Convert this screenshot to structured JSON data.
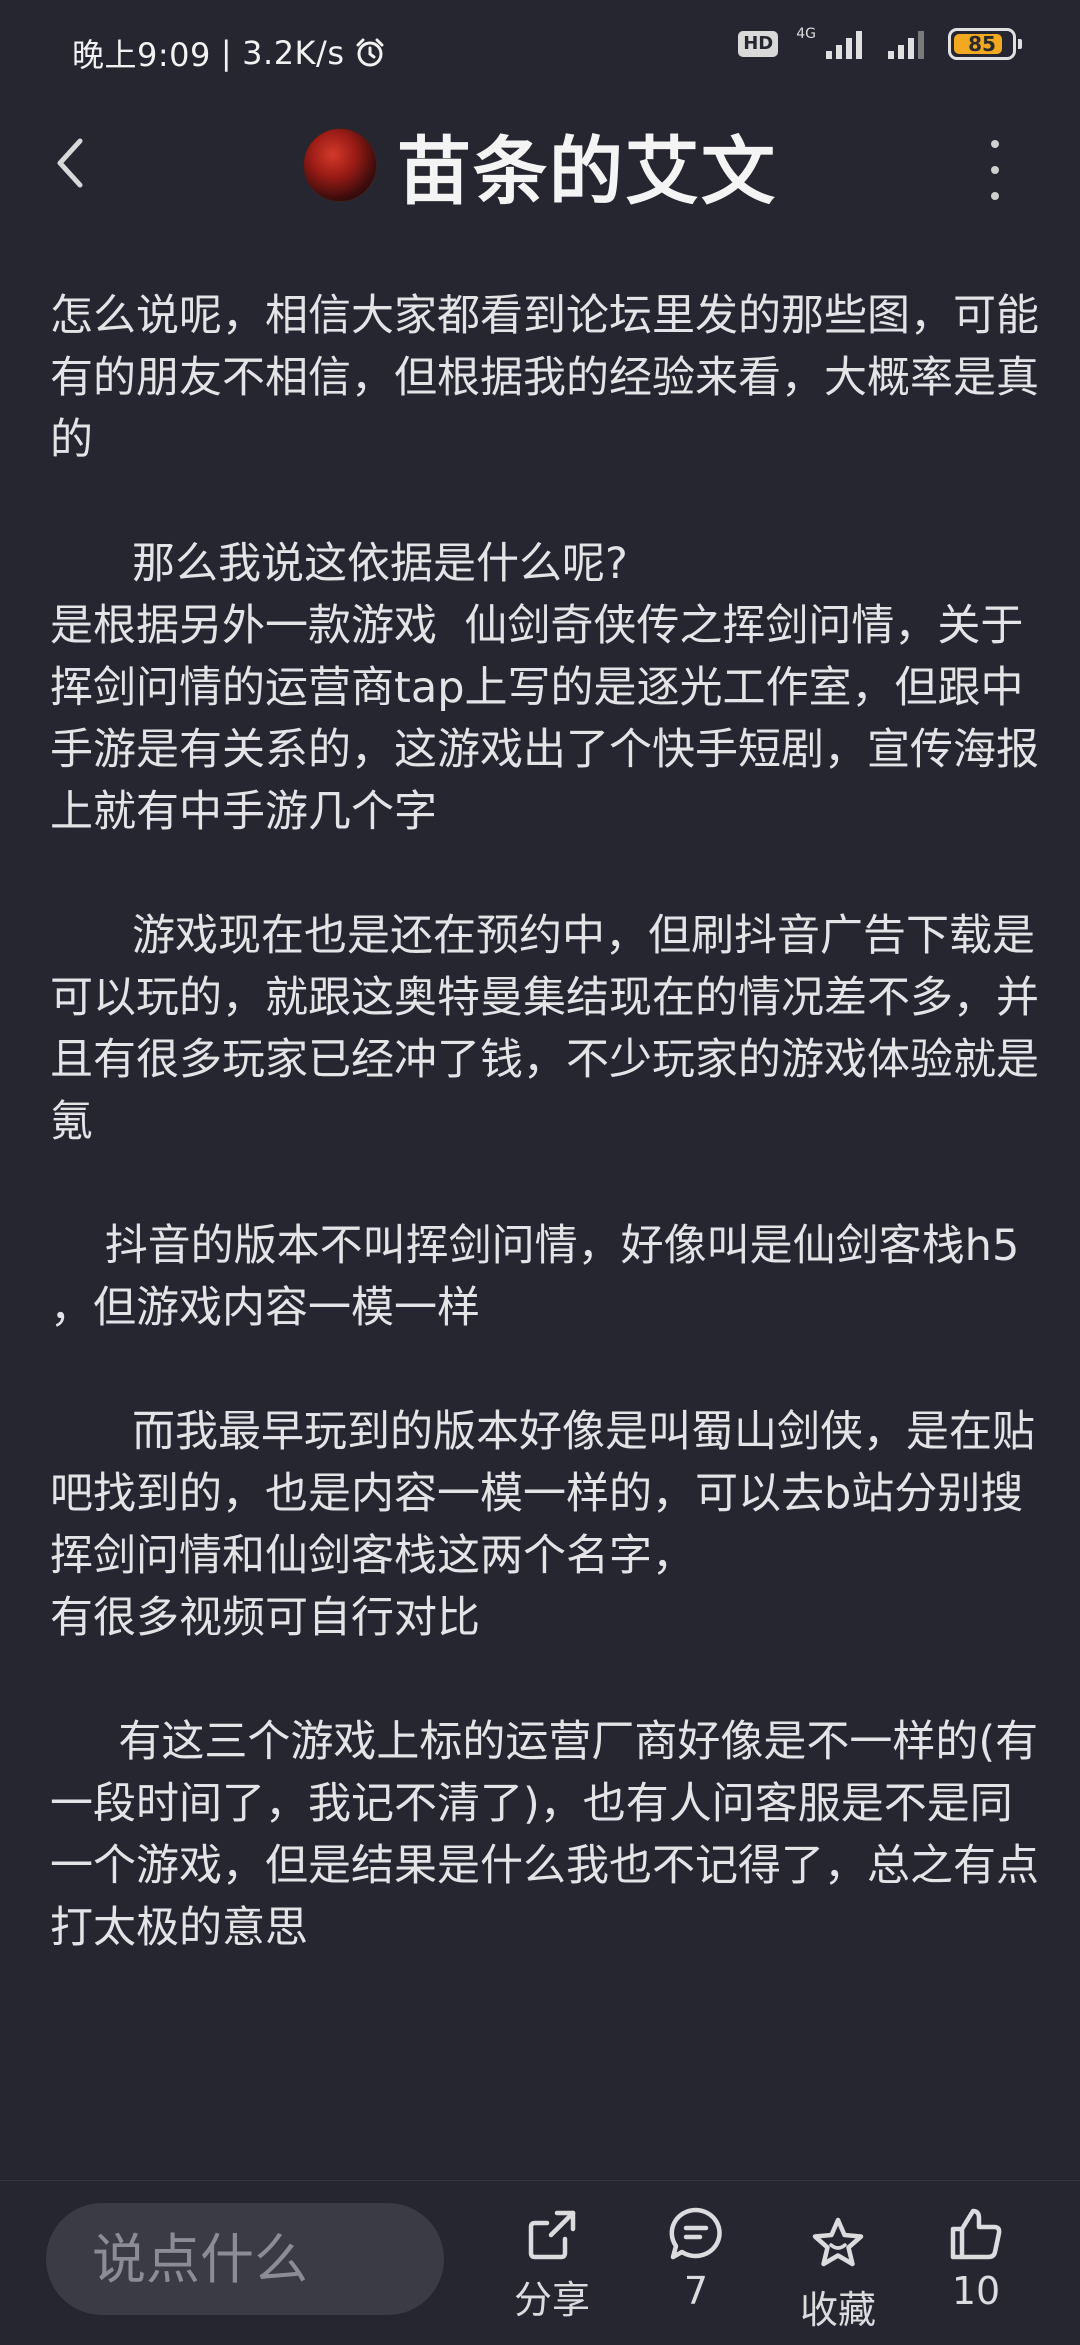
{
  "status_bar": {
    "time": "晚上9:09",
    "separator": "|",
    "speed": "3.2K/s",
    "hd": "HD",
    "network": "4G",
    "battery": "85",
    "battery_fraction": 0.85,
    "battery_color": "#f2a81f"
  },
  "header": {
    "title": "苗条的艾文"
  },
  "article": {
    "paragraphs": [
      "怎么说呢，相信大家都看到论坛里发的那些图，可能有的朋友不相信，但根据我的经验来看，大概率是真的",
      "      那么我说这依据是什么呢?\n是根据另外一款游戏  仙剑奇侠传之挥剑问情，关于挥剑问情的运营商tap上写的是逐光工作室，但跟中手游是有关系的，这游戏出了个快手短剧，宣传海报上就有中手游几个字",
      "      游戏现在也是还在预约中，但刷抖音广告下载是可以玩的，就跟这奥特曼集结现在的情况差不多，并且有很多玩家已经冲了钱，不少玩家的游戏体验就是氪",
      "    抖音的版本不叫挥剑问情，好像叫是仙剑客栈h5 ，但游戏内容一模一样",
      "      而我最早玩到的版本好像是叫蜀山剑侠，是在贴吧找到的，也是内容一模一样的，可以去b站分别搜挥剑问情和仙剑客栈这两个名字，\n有很多视频可自行对比",
      "     有这三个游戏上标的运营厂商好像是不一样的(有一段时间了，我记不清了)，也有人问客服是不是同一个游戏，但是结果是什么我也不记得了，总之有点打太极的意思"
    ]
  },
  "bottom_bar": {
    "comment_placeholder": "说点什么",
    "share_label": "分享",
    "comment_count": "7",
    "favorite_label": "收藏",
    "like_count": "10"
  },
  "icons": {
    "back": "chevron-left-icon",
    "more": "more-vertical-icon",
    "share": "share-icon",
    "comment": "comment-icon",
    "favorite": "star-icon",
    "like": "thumbs-up-icon",
    "alarm": "alarm-icon"
  }
}
